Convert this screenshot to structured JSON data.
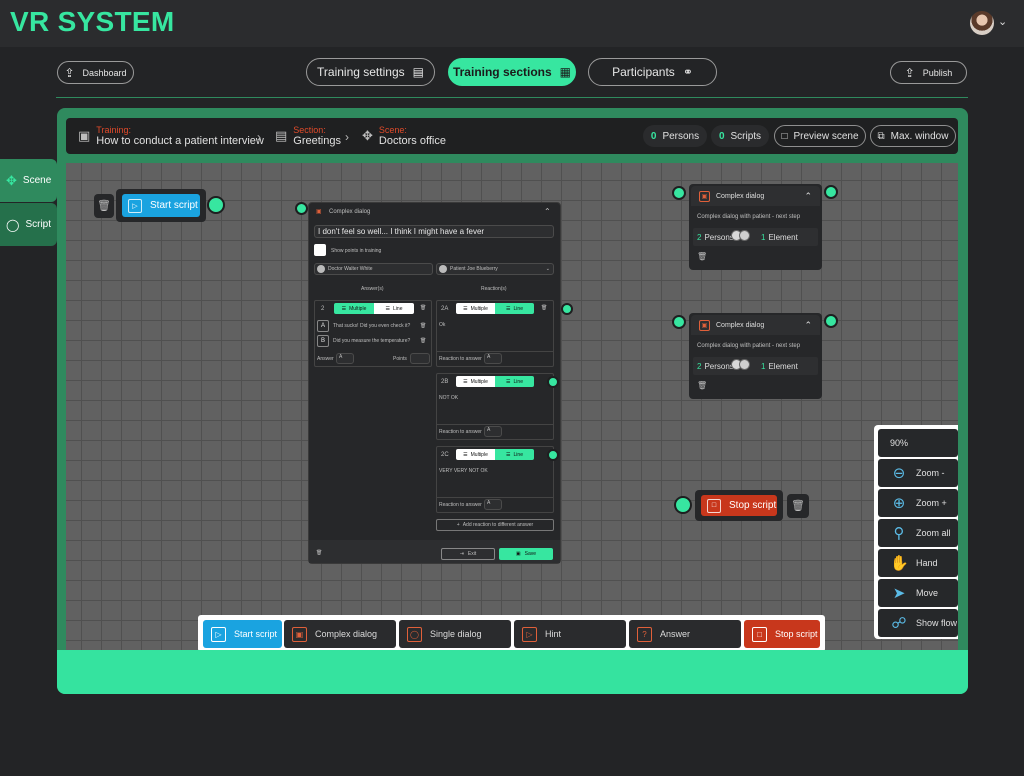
{
  "app": {
    "title": "VR SYSTEM"
  },
  "nav": {
    "dashboard": "Dashboard",
    "training_settings": "Training settings",
    "training_sections": "Training sections",
    "participants": "Participants",
    "publish": "Publish"
  },
  "breadcrumb": {
    "training_label": "Training:",
    "training_value": "How to conduct a patient interview",
    "section_label": "Section:",
    "section_value": "Greetings",
    "scene_label": "Scene:",
    "scene_value": "Doctors office"
  },
  "chips": {
    "persons_count": "0",
    "persons_label": "Persons",
    "scripts_count": "0",
    "scripts_label": "Scripts",
    "preview": "Preview scene",
    "max_window": "Max. window"
  },
  "side": {
    "scene": "Scene",
    "script": "Script"
  },
  "start_node": {
    "label": "Start script"
  },
  "stop_node": {
    "label": "Stop script"
  },
  "dialog_editor": {
    "title": "Complex dialog",
    "text": "I don't feel so well... I think I might have a fever",
    "show_points": "Show points in training",
    "person_left": "Doctor Walter White",
    "person_right": "Patient Joe Blueberry",
    "answers_header": "Answer(s)",
    "reactions_header": "Reaction(s)",
    "answer_block": {
      "number": "2",
      "multiple": "Multiple",
      "line": "Line",
      "items": [
        {
          "letter": "A",
          "text": "That sucks! Did you even check it?"
        },
        {
          "letter": "B",
          "text": "Did you measure the temperature?"
        }
      ],
      "answer_label": "Answer",
      "answer_value": "A",
      "points_label": "Points"
    },
    "reactions": [
      {
        "id": "2A",
        "text": "Ok",
        "reaction_label": "Reaction to answer",
        "value": "A"
      },
      {
        "id": "2B",
        "text": "NOT OK",
        "reaction_label": "Reaction to answer",
        "value": "A"
      },
      {
        "id": "2C",
        "text": "VERY VERY NOT OK",
        "reaction_label": "Reaction to answer",
        "value": "A"
      }
    ],
    "toggle_multiple": "Multiple",
    "toggle_line": "Line",
    "add_reaction": "Add reaction to different answer",
    "exit": "Exit",
    "save": "Save"
  },
  "cd_nodes": [
    {
      "title": "Complex dialog",
      "subtitle": "Complex dialog with patient - next step",
      "persons_count": "2",
      "persons_label": "Persons",
      "elements_count": "1",
      "elements_label": "Element"
    },
    {
      "title": "Complex dialog",
      "subtitle": "Complex dialog with patient - next step",
      "persons_count": "2",
      "persons_label": "Persons",
      "elements_count": "1",
      "elements_label": "Element"
    }
  ],
  "tools": {
    "zoom_level": "90%",
    "zoom_out": "Zoom -",
    "zoom_in": "Zoom +",
    "zoom_all": "Zoom all",
    "hand": "Hand",
    "move": "Move",
    "show_flow": "Show flow"
  },
  "palette": {
    "start": "Start script",
    "complex": "Complex dialog",
    "single": "Single dialog",
    "hint": "Hint",
    "answer": "Answer",
    "stop": "Stop script"
  },
  "colors": {
    "accent": "#37e6a0",
    "blue": "#1aa3e0",
    "red": "#c8371c",
    "frame": "#2f8a5e"
  }
}
